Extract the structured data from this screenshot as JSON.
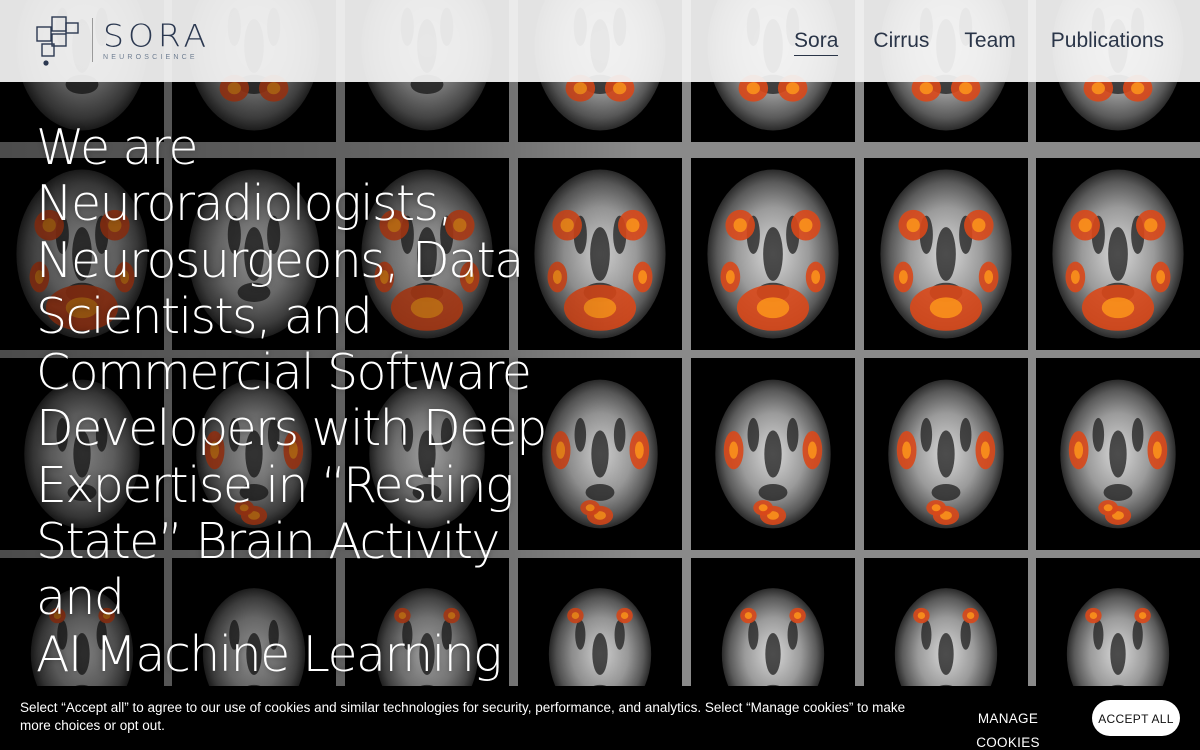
{
  "header": {
    "logo": {
      "wordmark": "SORA",
      "subtitle": "NEUROSCIENCE"
    },
    "nav": [
      {
        "label": "Sora",
        "active": true
      },
      {
        "label": "Cirrus",
        "active": false
      },
      {
        "label": "Team",
        "active": false
      },
      {
        "label": "Publications",
        "active": false
      }
    ]
  },
  "hero": {
    "headline": "We are\nNeuroradiologists,\nNeurosurgeons,  Data\nScientists, and\nCommercial Software\nDevelopers with Deep\nExpertise in  “Resting\nState” Brain Activity and\nAI Machine Learning"
  },
  "background": {
    "image": "brain-scan-grid",
    "colors": {
      "grid_line": "#8a8a8a",
      "activation": "#d9481a",
      "activation_core": "#ff9a1a"
    }
  },
  "cookie_banner": {
    "text": "Select “Accept all” to agree to our use of cookies and similar technologies for security, performance, and analytics. Select “Manage cookies” to make more choices or opt out.",
    "manage_label": "MANAGE COOKIES",
    "accept_label": "ACCEPT ALL"
  }
}
